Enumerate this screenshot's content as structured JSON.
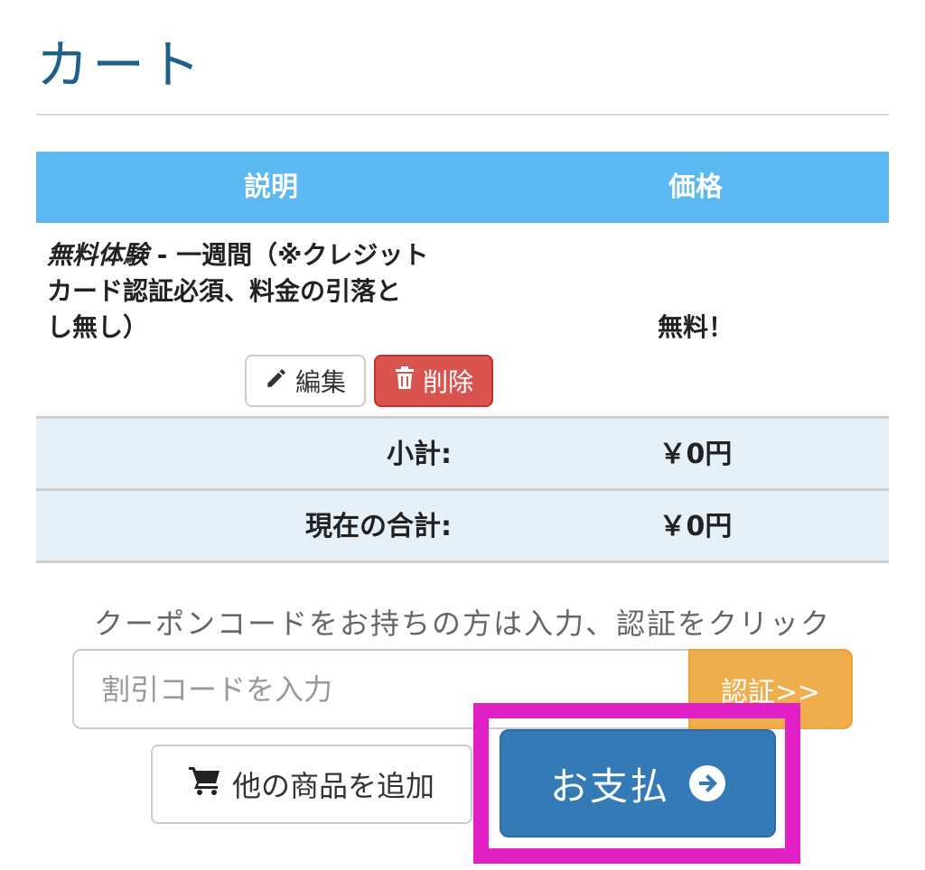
{
  "page": {
    "title": "カート"
  },
  "table": {
    "headers": {
      "description": "説明",
      "price": "価格"
    },
    "item": {
      "name": "無料体験",
      "separator": " - ",
      "line1_rest": "一週間（※クレジット",
      "line2": "カード認証必須、料金の引落と",
      "line3": "し無し）",
      "price": "無料！",
      "edit_label": "編集",
      "delete_label": "削除"
    },
    "subtotal": {
      "label": "小計:",
      "value": "￥0円"
    },
    "total": {
      "label": "現在の合計:",
      "value": "￥0円"
    }
  },
  "coupon": {
    "hint": "クーポンコードをお持ちの方は入力、認証をクリック",
    "placeholder": "割引コードを入力",
    "value": "",
    "button_label": "認証>>"
  },
  "actions": {
    "add_products_label": "他の商品を追加",
    "checkout_label": "お支払"
  },
  "colors": {
    "table_header": "#5bb8f0",
    "summary_bg": "#e6f0f9",
    "delete": "#d9534f",
    "coupon_button": "#f0ad4e",
    "checkout": "#337ab7",
    "highlight": "#e01fc4",
    "title": "#1f5f8b"
  },
  "icons": {
    "edit": "pencil-icon",
    "delete": "trash-icon",
    "add_products": "cart-icon",
    "checkout": "arrow-circle-right-icon"
  }
}
